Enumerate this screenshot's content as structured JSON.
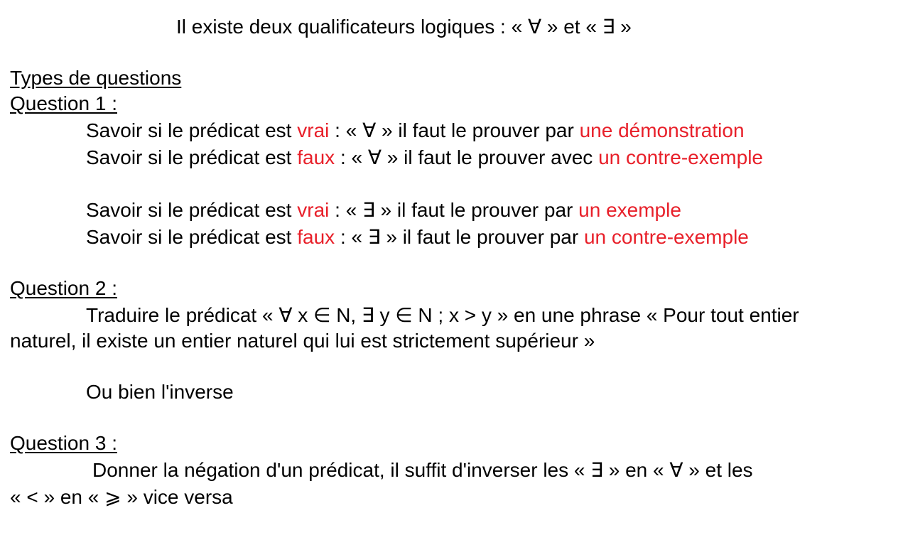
{
  "intro": {
    "text": "Il existe deux qualificateurs logiques : « ∀ » et « ∃ »"
  },
  "section_title": "Types de questions",
  "q1": {
    "heading": "Question 1 :",
    "lines": [
      {
        "a": "Savoir si le prédicat est ",
        "b": "vrai",
        "c": " : « ∀ » il faut le prouver par ",
        "d": "une démonstration"
      },
      {
        "a": "Savoir si le prédicat est ",
        "b": "faux",
        "c": " : « ∀ » il faut le prouver avec ",
        "d": "un contre-exemple"
      },
      {
        "a": "Savoir si le prédicat est ",
        "b": "vrai",
        "c": " : « ∃ » il faut le prouver par ",
        "d": "un exemple"
      },
      {
        "a": "Savoir si le prédicat est ",
        "b": "faux",
        "c": " : « ∃ » il faut le prouver par ",
        "d": "un contre-exemple"
      }
    ]
  },
  "q2": {
    "heading": "Question 2 :",
    "line1": "Traduire le prédicat « ∀ x ∈ N, ∃ y ∈ N ; x > y » en une phrase « Pour tout entier",
    "line2": "naturel, il existe un entier naturel qui lui est strictement supérieur »",
    "line3": "Ou bien l'inverse"
  },
  "q3": {
    "heading": "Question 3 :",
    "line1": "Donner la négation d'un prédicat, il suffit d'inverser les « ∃ » en « ∀ » et les",
    "line2": "« < » en « ⩾ » vice versa"
  },
  "colors": {
    "text": "#000000",
    "highlight": "#e8202a"
  }
}
